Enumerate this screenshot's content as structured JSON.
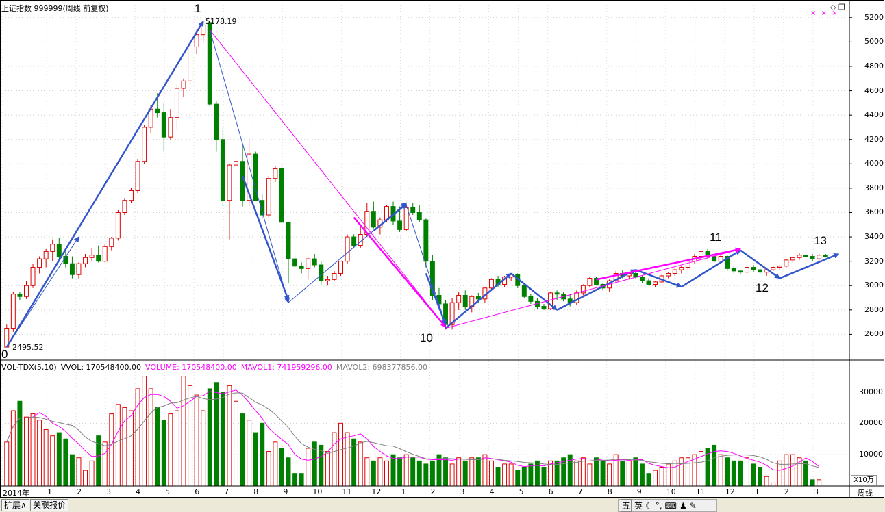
{
  "header": {
    "title": "上证指数 999999(周线 前复权)",
    "stars": "× × ×",
    "icons": [
      "diamond-icon",
      "restore-icon"
    ]
  },
  "price_axis": {
    "min": 2400,
    "max": 5300,
    "ticks": [
      "5200",
      "5000",
      "4800",
      "4600",
      "4400",
      "4200",
      "4000",
      "3800",
      "3600",
      "3400",
      "3200",
      "3000",
      "2800",
      "2600"
    ]
  },
  "annotations": {
    "high": "5178.19",
    "low": "2495.52"
  },
  "wave_labels": [
    "0",
    "1",
    "10",
    "11",
    "12",
    "13"
  ],
  "volume": {
    "indicator": "VOL-TDX(5,10)",
    "vvol": "VVOL: 170548400.00",
    "volume": "VOLUME: 170548400.00",
    "mavol1": "MAVOL1: 741959296.00",
    "mavol2": "MAVOL2: 698377856.00",
    "ticks": [
      "30000",
      "20000",
      "10000"
    ],
    "unit": "X10万",
    "colors": {
      "volume": "#ff00ff",
      "mavol1": "#ff00ff",
      "mavol2": "#808080"
    }
  },
  "x_axis": {
    "labels": [
      "2014年",
      "1",
      "2",
      "3",
      "4",
      "5",
      "6",
      "7",
      "8",
      "9",
      "10",
      "11",
      "12",
      "1",
      "2",
      "3",
      "4",
      "5",
      "6",
      "7",
      "8",
      "9",
      "10",
      "11",
      "12",
      "1",
      "2",
      "3"
    ],
    "period": "周线"
  },
  "bottom_bar": {
    "tabs": [
      "扩展∧",
      "关联报价"
    ],
    "ime": [
      "五",
      "英"
    ]
  },
  "chart_data": {
    "type": "candlestick",
    "series_note": "weekly OHLC, Shanghai Composite",
    "candles": [
      [
        2495,
        2680,
        2495,
        2650
      ],
      [
        2650,
        2950,
        2620,
        2930
      ],
      [
        2930,
        2950,
        2880,
        2910
      ],
      [
        2910,
        3040,
        2890,
        3000
      ],
      [
        3000,
        3180,
        2980,
        3150
      ],
      [
        3150,
        3240,
        3100,
        3220
      ],
      [
        3220,
        3300,
        3150,
        3280
      ],
      [
        3280,
        3380,
        3200,
        3340
      ],
      [
        3340,
        3390,
        3200,
        3240
      ],
      [
        3240,
        3280,
        3150,
        3180
      ],
      [
        3180,
        3240,
        3060,
        3090
      ],
      [
        3090,
        3190,
        3060,
        3180
      ],
      [
        3180,
        3260,
        3150,
        3230
      ],
      [
        3230,
        3310,
        3200,
        3250
      ],
      [
        3250,
        3330,
        3190,
        3200
      ],
      [
        3200,
        3340,
        3190,
        3320
      ],
      [
        3320,
        3400,
        3290,
        3390
      ],
      [
        3390,
        3620,
        3370,
        3600
      ],
      [
        3600,
        3720,
        3580,
        3700
      ],
      [
        3700,
        3800,
        3680,
        3780
      ],
      [
        3780,
        4040,
        3760,
        4020
      ],
      [
        4020,
        4320,
        4000,
        4300
      ],
      [
        4300,
        4480,
        4250,
        4450
      ],
      [
        4450,
        4580,
        4380,
        4420
      ],
      [
        4420,
        4500,
        4100,
        4220
      ],
      [
        4220,
        4450,
        4200,
        4380
      ],
      [
        4380,
        4650,
        4280,
        4620
      ],
      [
        4620,
        4700,
        4550,
        4680
      ],
      [
        4680,
        5000,
        4650,
        4960
      ],
      [
        4960,
        5100,
        4900,
        5060
      ],
      [
        5060,
        5178,
        5000,
        5140
      ],
      [
        5160,
        5178,
        4470,
        4490
      ],
      [
        4490,
        4520,
        4100,
        4200
      ],
      [
        4200,
        4300,
        3650,
        3700
      ],
      [
        3700,
        4000,
        3380,
        3990
      ],
      [
        3990,
        4150,
        3950,
        4020
      ],
      [
        4020,
        4150,
        3650,
        3700
      ],
      [
        3700,
        4200,
        3650,
        4080
      ],
      [
        4080,
        4100,
        3700,
        3700
      ],
      [
        3700,
        3750,
        3550,
        3580
      ],
      [
        3580,
        3900,
        3560,
        3880
      ],
      [
        3880,
        3980,
        3850,
        3960
      ],
      [
        3960,
        4000,
        3500,
        3520
      ],
      [
        3520,
        3520,
        3020,
        3220
      ],
      [
        3220,
        3250,
        3150,
        3160
      ],
      [
        3160,
        3190,
        3100,
        3140
      ],
      [
        3140,
        3230,
        3050,
        3220
      ],
      [
        3220,
        3260,
        3150,
        3170
      ],
      [
        3170,
        3200,
        3000,
        3040
      ],
      [
        3040,
        3080,
        3000,
        3050
      ],
      [
        3050,
        3120,
        3040,
        3100
      ],
      [
        3100,
        3200,
        3080,
        3200
      ],
      [
        3200,
        3420,
        3180,
        3400
      ],
      [
        3400,
        3420,
        3310,
        3330
      ],
      [
        3330,
        3480,
        3310,
        3420
      ],
      [
        3420,
        3680,
        3400,
        3610
      ],
      [
        3610,
        3690,
        3470,
        3480
      ],
      [
        3480,
        3560,
        3420,
        3540
      ],
      [
        3540,
        3660,
        3520,
        3650
      ],
      [
        3650,
        3690,
        3500,
        3530
      ],
      [
        3530,
        3650,
        3440,
        3460
      ],
      [
        3460,
        3670,
        3450,
        3640
      ],
      [
        3640,
        3680,
        3580,
        3600
      ],
      [
        3600,
        3660,
        3520,
        3540
      ],
      [
        3540,
        3550,
        3150,
        3200
      ],
      [
        3200,
        3250,
        2880,
        2920
      ],
      [
        2920,
        2980,
        2840,
        2850
      ],
      [
        2850,
        2880,
        2640,
        2680
      ],
      [
        2680,
        2900,
        2640,
        2860
      ],
      [
        2860,
        2950,
        2800,
        2920
      ],
      [
        2920,
        2960,
        2800,
        2830
      ],
      [
        2830,
        2920,
        2780,
        2910
      ],
      [
        2910,
        2940,
        2860,
        2890
      ],
      [
        2890,
        2990,
        2860,
        2980
      ],
      [
        2980,
        3060,
        2960,
        3050
      ],
      [
        3050,
        3080,
        2990,
        3010
      ],
      [
        3010,
        3080,
        2990,
        3070
      ],
      [
        3070,
        3100,
        3040,
        3090
      ],
      [
        3090,
        3100,
        2980,
        3000
      ],
      [
        3000,
        3020,
        2900,
        2910
      ],
      [
        2910,
        2930,
        2850,
        2870
      ],
      [
        2870,
        2900,
        2810,
        2830
      ],
      [
        2830,
        2850,
        2800,
        2810
      ],
      [
        2810,
        2950,
        2800,
        2940
      ],
      [
        2940,
        2960,
        2880,
        2930
      ],
      [
        2930,
        2950,
        2870,
        2890
      ],
      [
        2890,
        2930,
        2830,
        2860
      ],
      [
        2860,
        2960,
        2840,
        2940
      ],
      [
        2940,
        3010,
        2920,
        3000
      ],
      [
        3000,
        3070,
        2990,
        3060
      ],
      [
        3060,
        3070,
        3000,
        3010
      ],
      [
        3010,
        3020,
        2960,
        2980
      ],
      [
        2980,
        3050,
        2950,
        3040
      ],
      [
        3040,
        3120,
        3020,
        3100
      ],
      [
        3100,
        3130,
        3060,
        3080
      ],
      [
        3080,
        3110,
        3050,
        3100
      ],
      [
        3100,
        3120,
        3060,
        3070
      ],
      [
        3070,
        3080,
        3020,
        3040
      ],
      [
        3040,
        3060,
        3000,
        3010
      ],
      [
        3010,
        3040,
        2990,
        3030
      ],
      [
        3030,
        3090,
        3020,
        3080
      ],
      [
        3080,
        3110,
        3060,
        3100
      ],
      [
        3100,
        3140,
        3080,
        3130
      ],
      [
        3130,
        3160,
        3100,
        3150
      ],
      [
        3150,
        3220,
        3130,
        3200
      ],
      [
        3200,
        3260,
        3180,
        3240
      ],
      [
        3240,
        3300,
        3220,
        3280
      ],
      [
        3280,
        3300,
        3220,
        3240
      ],
      [
        3240,
        3250,
        3190,
        3200
      ],
      [
        3200,
        3260,
        3180,
        3240
      ],
      [
        3240,
        3250,
        3120,
        3140
      ],
      [
        3140,
        3160,
        3100,
        3120
      ],
      [
        3120,
        3130,
        3090,
        3110
      ],
      [
        3110,
        3160,
        3090,
        3150
      ],
      [
        3150,
        3170,
        3110,
        3130
      ],
      [
        3130,
        3160,
        3100,
        3110
      ],
      [
        3110,
        3140,
        3080,
        3130
      ],
      [
        3130,
        3160,
        3120,
        3150
      ],
      [
        3150,
        3170,
        3130,
        3160
      ],
      [
        3160,
        3220,
        3150,
        3210
      ],
      [
        3210,
        3240,
        3190,
        3230
      ],
      [
        3230,
        3270,
        3210,
        3250
      ],
      [
        3250,
        3280,
        3220,
        3240
      ],
      [
        3240,
        3260,
        3200,
        3220
      ],
      [
        3220,
        3260,
        3200,
        3250
      ],
      [
        3250,
        3260,
        3230,
        3240
      ]
    ],
    "volumes": [
      14000,
      24000,
      27000,
      22000,
      23000,
      21000,
      18000,
      16000,
      17000,
      15000,
      10000,
      9000,
      5000,
      8000,
      16000,
      14000,
      23000,
      26000,
      25000,
      24000,
      31000,
      35000,
      31000,
      25000,
      21000,
      23000,
      24000,
      35000,
      32000,
      29000,
      24000,
      31000,
      33000,
      30000,
      32000,
      27000,
      23000,
      21000,
      17000,
      20000,
      11000,
      14000,
      12000,
      9000,
      4000,
      4000,
      12000,
      14000,
      13000,
      11000,
      17000,
      20000,
      17000,
      15000,
      14000,
      9000,
      8000,
      9000,
      8000,
      10000,
      9000,
      10000,
      9000,
      8000,
      7000,
      8000,
      10000,
      9000,
      7000,
      9000,
      8000,
      9000,
      9000,
      10000,
      8000,
      6000,
      7000,
      7000,
      5000,
      6000,
      7000,
      8000,
      6000,
      8000,
      8000,
      9000,
      10000,
      8000,
      9000,
      7000,
      9000,
      8000,
      7000,
      10000,
      8000,
      8000,
      9000,
      7000,
      4000,
      5000,
      6000,
      7000,
      8000,
      9000,
      9000,
      10000,
      11000,
      12000,
      13000,
      10000,
      9000,
      8000,
      8000,
      9000,
      7000,
      6000,
      3000,
      1000,
      8000,
      10000,
      10000,
      9000,
      8000,
      2000,
      2000
    ]
  }
}
